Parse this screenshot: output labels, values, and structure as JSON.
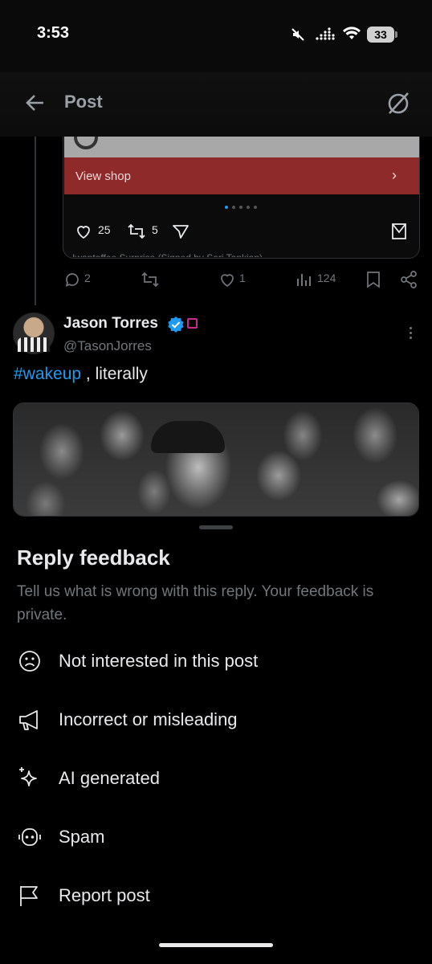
{
  "status_bar": {
    "time": "3:53",
    "battery": "33"
  },
  "header": {
    "back_icon": "back-arrow-icon",
    "title": "Post",
    "grok_icon": "grok-icon"
  },
  "parent_post": {
    "card_button": "View shop",
    "card_stats": {
      "likes": "25",
      "reposts": "5"
    },
    "clipped_caption": "Iwantoffee Surprise (Signed by Serj Tankian)",
    "actions": {
      "replies": "2",
      "likes": "1",
      "views": "124"
    }
  },
  "reply_post": {
    "author_name": "Jason Torres",
    "handle": "@TasonJorres",
    "hashtag": "#wakeup",
    "text_rest": " , literally",
    "colors": {
      "link": "#1d9bf0",
      "verified": "#1d9bf0",
      "affiliate": "#c52a8f"
    }
  },
  "feedback_sheet": {
    "title": "Reply feedback",
    "subtitle": "Tell us what is wrong with this reply. Your feedback is private.",
    "options": [
      {
        "label": "Not interested in this post",
        "icon": "sad-face-icon"
      },
      {
        "label": "Incorrect or misleading",
        "icon": "megaphone-icon"
      },
      {
        "label": "AI generated",
        "icon": "sparkle-icon"
      },
      {
        "label": "Spam",
        "icon": "robot-icon"
      },
      {
        "label": "Report post",
        "icon": "flag-icon"
      }
    ]
  }
}
